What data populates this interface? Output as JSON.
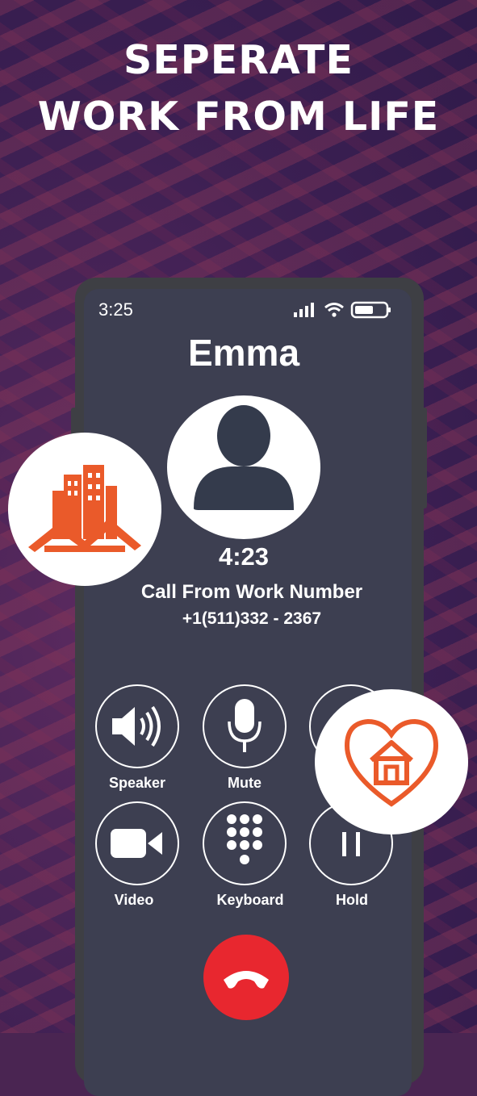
{
  "headline": {
    "line1": "SEPERATE",
    "line2": "WORK FROM LIFE"
  },
  "status_bar": {
    "time": "3:25",
    "icons": [
      "signal-icon",
      "wifi-icon",
      "battery-icon"
    ]
  },
  "call": {
    "caller_name": "Emma",
    "timer": "4:23",
    "subtitle": "Call From Work Number",
    "phone_number": "+1(511)332 - 2367"
  },
  "controls": [
    {
      "label": "Speaker",
      "icon": "speaker-icon"
    },
    {
      "label": "Mute",
      "icon": "microphone-icon"
    },
    {
      "label": "",
      "icon": "add-call-icon"
    },
    {
      "label": "Video",
      "icon": "video-camera-icon"
    },
    {
      "label": "Keyboard",
      "icon": "keypad-icon"
    },
    {
      "label": "Hold",
      "icon": "pause-icon"
    }
  ],
  "colors": {
    "accent_orange": "#ea5a2a",
    "end_call_red": "#e8272f",
    "screen": "#3d3f51"
  }
}
